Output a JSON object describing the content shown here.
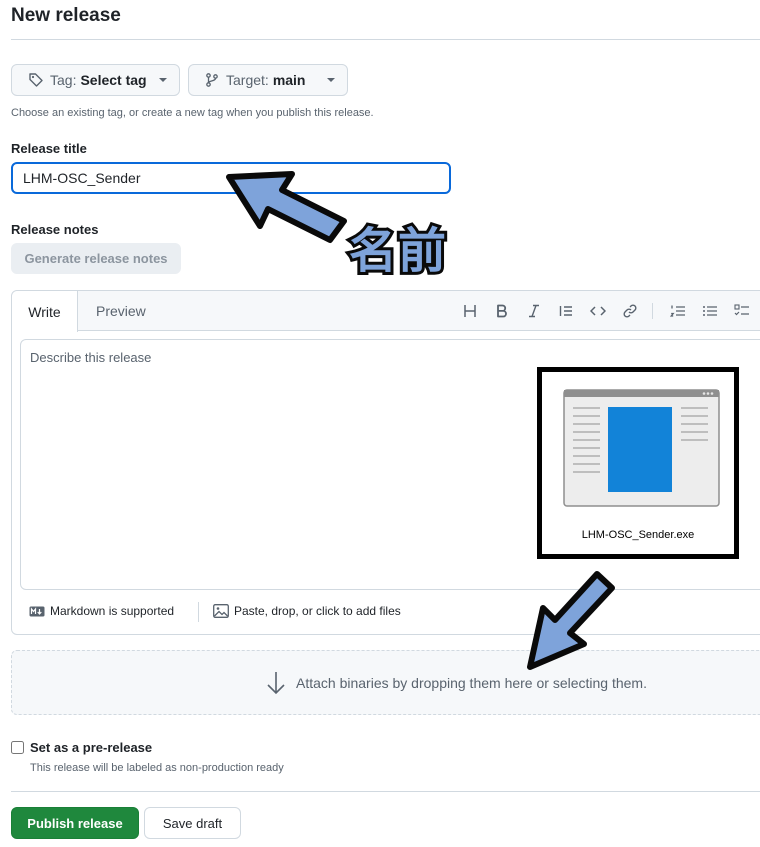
{
  "page": {
    "title": "New release"
  },
  "tag_button": {
    "prefix": "Tag:",
    "value": "Select tag"
  },
  "target_button": {
    "prefix": "Target:",
    "value": "main"
  },
  "hint": "Choose an existing tag, or create a new tag when you publish this release.",
  "release_title": {
    "label": "Release title",
    "value": "LHM-OSC_Sender"
  },
  "release_notes": {
    "label": "Release notes",
    "generate_label": "Generate release notes",
    "tabs": {
      "write": "Write",
      "preview": "Preview"
    },
    "toolbar": [
      "heading-icon",
      "bold-icon",
      "italic-icon",
      "quote-icon",
      "code-icon",
      "link-icon",
      "ordered-list-icon",
      "unordered-list-icon",
      "task-list-icon"
    ],
    "placeholder": "Describe this release",
    "markdown_label": "Markdown is supported",
    "files_label": "Paste, drop, or click to add files"
  },
  "attach": {
    "label": "Attach binaries by dropping them here or selecting them."
  },
  "prerelease": {
    "label": "Set as a pre-release",
    "description": "This release will be labeled as non-production ready",
    "checked": false
  },
  "actions": {
    "publish": "Publish release",
    "draft": "Save draft"
  },
  "annotations": {
    "name_label": "名前",
    "file_name": "LHM-OSC_Sender.exe",
    "arrow_color": "#7ea3da"
  },
  "colors": {
    "accent": "#0969da",
    "publish": "#1f883d",
    "file_icon_blue": "#1283d8"
  }
}
